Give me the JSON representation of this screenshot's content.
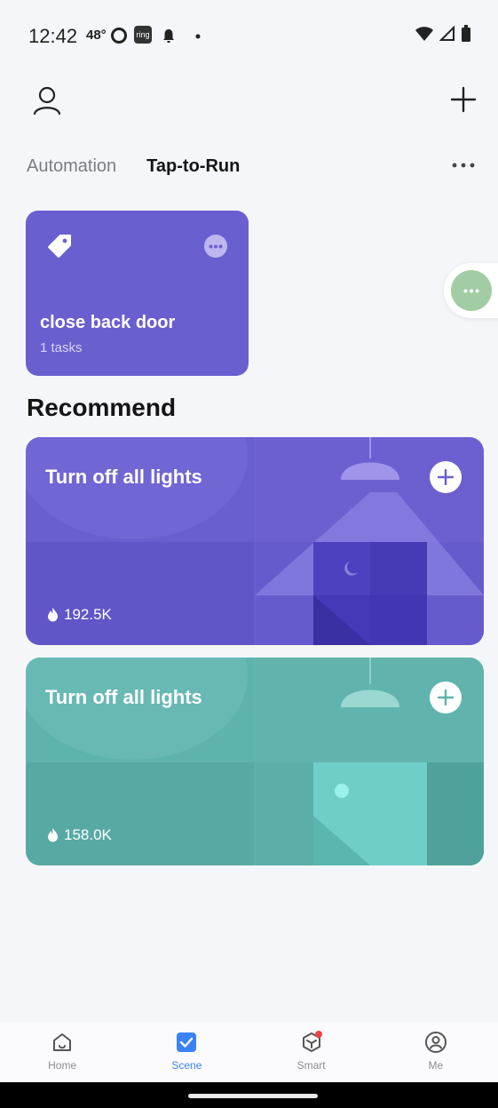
{
  "status_bar": {
    "time": "12:42",
    "temperature": "48°",
    "ring_label": "ring"
  },
  "tabs": {
    "automation": "Automation",
    "tap_to_run": "Tap-to-Run",
    "active": "Tap-to-Run"
  },
  "scene_card": {
    "name": "close back door",
    "tasks": "1 tasks",
    "color": "#6a5fcf"
  },
  "recommend": {
    "title": "Recommend",
    "cards": [
      {
        "title": "Turn off all lights",
        "count": "192.5K",
        "color": "#6a5fcf"
      },
      {
        "title": "Turn off all lights",
        "count": "158.0K",
        "color": "#5fb3ad"
      }
    ]
  },
  "bottom_nav": {
    "items": [
      {
        "label": "Home",
        "icon": "home-icon"
      },
      {
        "label": "Scene",
        "icon": "scene-check-icon"
      },
      {
        "label": "Smart",
        "icon": "smart-cube-icon"
      },
      {
        "label": "Me",
        "icon": "profile-icon"
      }
    ],
    "active": "Scene",
    "accent": "#3b82f6"
  }
}
